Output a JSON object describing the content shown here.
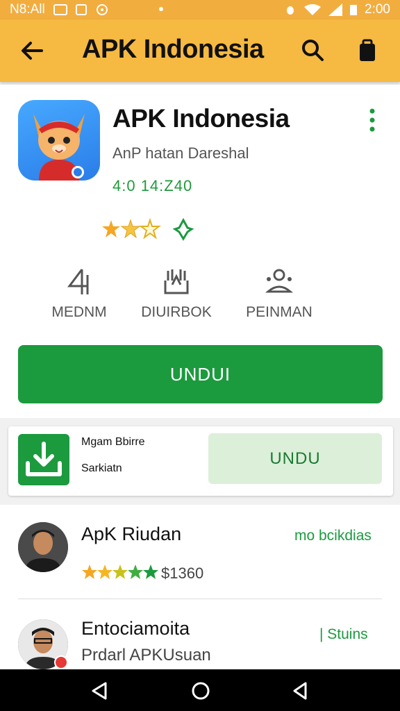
{
  "status_bar": {
    "left_text": "N8:All",
    "time": "2:00"
  },
  "app_bar": {
    "title": "APK Indonesia"
  },
  "app": {
    "name": "APK Indonesia",
    "subtitle": "AnP hatan Dareshal",
    "meta": "4:0 14:Z40",
    "rating_stars": 2.5
  },
  "stats": [
    {
      "icon": "number-icon",
      "label": "MEDNM"
    },
    {
      "icon": "box-icon",
      "label": "DIUIRBOK"
    },
    {
      "icon": "people-icon",
      "label": "PEINMAN"
    }
  ],
  "download_button": "UNDUI",
  "promo": {
    "name": "Mgam Bbirre",
    "subtitle": "Sarkiatn",
    "button": "UNDU"
  },
  "reviews": [
    {
      "name": "ApK Riudan",
      "action": "mo bcikdias",
      "stars": 5,
      "price": "$1360"
    },
    {
      "name": "Entociamoita",
      "action": "| Stuins",
      "subtitle": "Prdarl APKUsuan"
    }
  ],
  "colors": {
    "accent": "#f6b942",
    "primary_green": "#1b9a3e",
    "light_green": "#dcefd8"
  }
}
